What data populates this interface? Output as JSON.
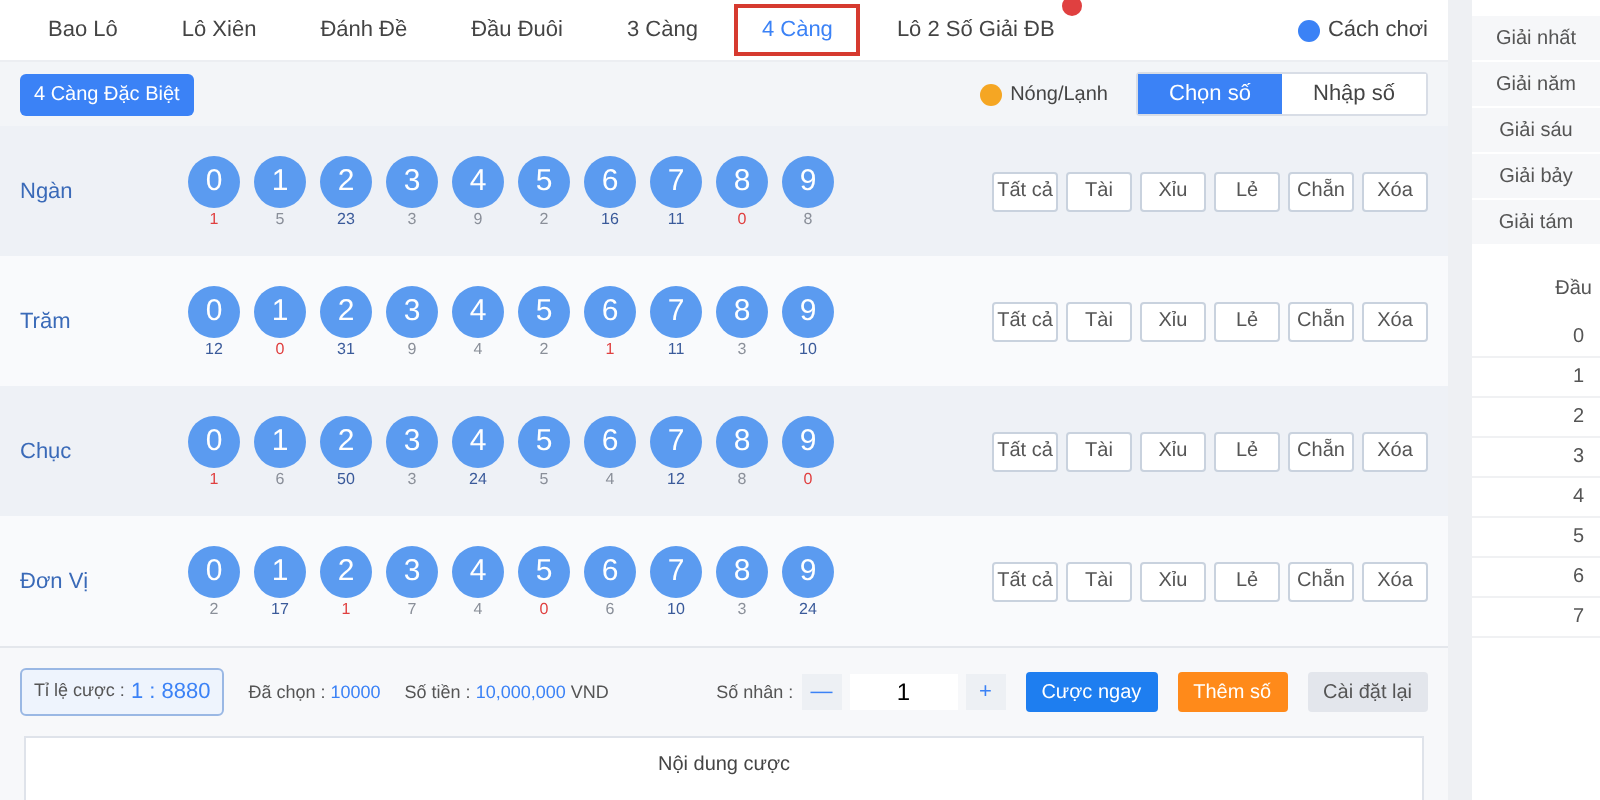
{
  "tabs": [
    {
      "label": "Bao Lô",
      "selected": false
    },
    {
      "label": "Lô Xiên",
      "selected": false
    },
    {
      "label": "Đánh Đề",
      "selected": false
    },
    {
      "label": "Đầu Đuôi",
      "selected": false
    },
    {
      "label": "3 Càng",
      "selected": false
    },
    {
      "label": "4 Càng",
      "selected": true
    },
    {
      "label": "Lô 2 Số Giải ĐB",
      "selected": false,
      "badge": true
    }
  ],
  "help_link": "Cách chơi",
  "subtype_button": "4 Càng Đặc Biệt",
  "hot_cold": "Nóng/Lạnh",
  "modes": [
    {
      "label": "Chọn số",
      "selected": true
    },
    {
      "label": "Nhập số",
      "selected": false
    }
  ],
  "digit_rows": [
    {
      "label": "Ngàn",
      "balls": [
        "0",
        "1",
        "2",
        "3",
        "4",
        "5",
        "6",
        "7",
        "8",
        "9"
      ],
      "counts": [
        {
          "text": "1",
          "color": "#e04040"
        },
        {
          "text": "5",
          "color": "#8a8f99"
        },
        {
          "text": "23",
          "color": "#3a5a9a"
        },
        {
          "text": "3",
          "color": "#8a8f99"
        },
        {
          "text": "9",
          "color": "#8a8f99"
        },
        {
          "text": "2",
          "color": "#8a8f99"
        },
        {
          "text": "16",
          "color": "#3a5a9a"
        },
        {
          "text": "11",
          "color": "#3a5a9a"
        },
        {
          "text": "0",
          "color": "#e04040"
        },
        {
          "text": "8",
          "color": "#8a8f99"
        }
      ],
      "actions": [
        "Tất cả",
        "Tài",
        "Xỉu",
        "Lẻ",
        "Chẵn",
        "Xóa"
      ]
    },
    {
      "label": "Trăm",
      "balls": [
        "0",
        "1",
        "2",
        "3",
        "4",
        "5",
        "6",
        "7",
        "8",
        "9"
      ],
      "counts": [
        {
          "text": "12",
          "color": "#3a5a9a"
        },
        {
          "text": "0",
          "color": "#e04040"
        },
        {
          "text": "31",
          "color": "#3a5a9a"
        },
        {
          "text": "9",
          "color": "#8a8f99"
        },
        {
          "text": "4",
          "color": "#8a8f99"
        },
        {
          "text": "2",
          "color": "#8a8f99"
        },
        {
          "text": "1",
          "color": "#e04040"
        },
        {
          "text": "11",
          "color": "#3a5a9a"
        },
        {
          "text": "3",
          "color": "#8a8f99"
        },
        {
          "text": "10",
          "color": "#3a5a9a"
        }
      ],
      "actions": [
        "Tất cả",
        "Tài",
        "Xỉu",
        "Lẻ",
        "Chẵn",
        "Xóa"
      ]
    },
    {
      "label": "Chục",
      "balls": [
        "0",
        "1",
        "2",
        "3",
        "4",
        "5",
        "6",
        "7",
        "8",
        "9"
      ],
      "counts": [
        {
          "text": "1",
          "color": "#e04040"
        },
        {
          "text": "6",
          "color": "#8a8f99"
        },
        {
          "text": "50",
          "color": "#3a5a9a"
        },
        {
          "text": "3",
          "color": "#8a8f99"
        },
        {
          "text": "24",
          "color": "#3a5a9a"
        },
        {
          "text": "5",
          "color": "#8a8f99"
        },
        {
          "text": "4",
          "color": "#8a8f99"
        },
        {
          "text": "12",
          "color": "#3a5a9a"
        },
        {
          "text": "8",
          "color": "#8a8f99"
        },
        {
          "text": "0",
          "color": "#e04040"
        }
      ],
      "actions": [
        "Tất cả",
        "Tài",
        "Xỉu",
        "Lẻ",
        "Chẵn",
        "Xóa"
      ]
    },
    {
      "label": "Đơn Vị",
      "balls": [
        "0",
        "1",
        "2",
        "3",
        "4",
        "5",
        "6",
        "7",
        "8",
        "9"
      ],
      "counts": [
        {
          "text": "2",
          "color": "#8a8f99"
        },
        {
          "text": "17",
          "color": "#3a5a9a"
        },
        {
          "text": "1",
          "color": "#e04040"
        },
        {
          "text": "7",
          "color": "#8a8f99"
        },
        {
          "text": "4",
          "color": "#8a8f99"
        },
        {
          "text": "0",
          "color": "#e04040"
        },
        {
          "text": "6",
          "color": "#8a8f99"
        },
        {
          "text": "10",
          "color": "#3a5a9a"
        },
        {
          "text": "3",
          "color": "#8a8f99"
        },
        {
          "text": "24",
          "color": "#3a5a9a"
        }
      ],
      "actions": [
        "Tất cả",
        "Tài",
        "Xỉu",
        "Lẻ",
        "Chẵn",
        "Xóa"
      ]
    }
  ],
  "footer": {
    "odds_label": "Tỉ lệ cược :",
    "odds_value": "1 : 8880",
    "chosen_label": "Đã chọn :",
    "chosen_value": "10000",
    "amount_label": "Số tiền :",
    "amount_value": "10,000,000",
    "currency": "VND",
    "multiplier_label": "Số nhân :",
    "minus": "—",
    "multiplier_value": "1",
    "plus": "+",
    "bet_button": "Cược ngay",
    "add_button": "Thêm số",
    "reset_button": "Cài đặt lại"
  },
  "bet_table": {
    "header": "Nội dung cược"
  },
  "sidebar": {
    "prizes": [
      "Giải nhất",
      "Giải năm",
      "Giải sáu",
      "Giải bảy",
      "Giải tám"
    ],
    "head_column": "Đầu",
    "heads": [
      "0",
      "1",
      "2",
      "3",
      "4",
      "5",
      "6",
      "7"
    ]
  }
}
